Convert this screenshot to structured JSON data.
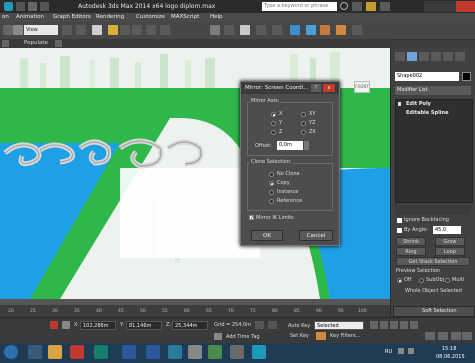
{
  "titlebar": {
    "title": "Autodesk 3ds Max 2014 x64     logo diplom.max",
    "search_placeholder": "Type a keyword or phrase"
  },
  "menubar": {
    "items": [
      "on",
      "Animation",
      "Graph Editors",
      "Rendering",
      "Customize",
      "MAXScript",
      "Help"
    ]
  },
  "toolbar": {
    "view_dropdown": "View"
  },
  "ribbon": {
    "label": "Populate"
  },
  "viewport": {
    "corner_label": "FRONT"
  },
  "dialog": {
    "title": "Mirror: Screen Coordi...",
    "help_icon": "?",
    "close_icon": "x",
    "mirror_axis_label": "Mirror Axis:",
    "axes": [
      "X",
      "Y",
      "Z",
      "XY",
      "YZ",
      "ZX"
    ],
    "selected_axis": "X",
    "offset_label": "Offset:",
    "offset_value": "0,0m",
    "clone_label": "Clone Selection:",
    "clone_options": [
      "No Clone",
      "Copy",
      "Instance",
      "Reference"
    ],
    "selected_clone": "Copy",
    "mirror_ik_label": "Mirror IK Limits",
    "mirror_ik_checked": true,
    "ok_label": "OK",
    "cancel_label": "Cancel"
  },
  "command_panel": {
    "object_name": "Shape002",
    "modifier_list": "Modifier List",
    "stack": [
      "Edit Poly",
      "Editable Spline"
    ],
    "ignore_backfacing": "Ignore Backfacing",
    "by_angle": "By Angle:",
    "by_angle_value": "45,0",
    "shrink": "Shrink",
    "grow": "Grow",
    "ring": "Ring",
    "loop": "Loop",
    "get_stack_selection": "Get Stack Selection",
    "preview_selection": "Preview Selection",
    "preview_off": "Off",
    "preview_subobj": "SubObj",
    "preview_multi": "Multi",
    "whole_object_selected": "Whole Object Selected",
    "soft_selection": "Soft Selection"
  },
  "timeline": {
    "ticks": [
      "20",
      "25",
      "30",
      "35",
      "40",
      "45",
      "50",
      "55",
      "60",
      "65",
      "70",
      "75",
      "80",
      "85",
      "90",
      "95",
      "100"
    ]
  },
  "status": {
    "x_label": "X:",
    "x_value": "102,286m",
    "y_label": "Y:",
    "y_value": "81,146m",
    "z_label": "Z:",
    "z_value": "25,344m",
    "grid": "Grid = 254,0m",
    "auto_key": "Auto Key",
    "selected": "Selected",
    "set_key": "Set Key",
    "key_filters": "Key Filters...",
    "add_time_tag": "Add Time Tag"
  },
  "taskbar": {
    "lang": "RU",
    "time": "15:18",
    "date": "08.06.2015"
  },
  "colors": {
    "green": "#2fb84a",
    "blue": "#1ea0e6",
    "panel": "#414141",
    "dialog": "#4d4d4d"
  }
}
